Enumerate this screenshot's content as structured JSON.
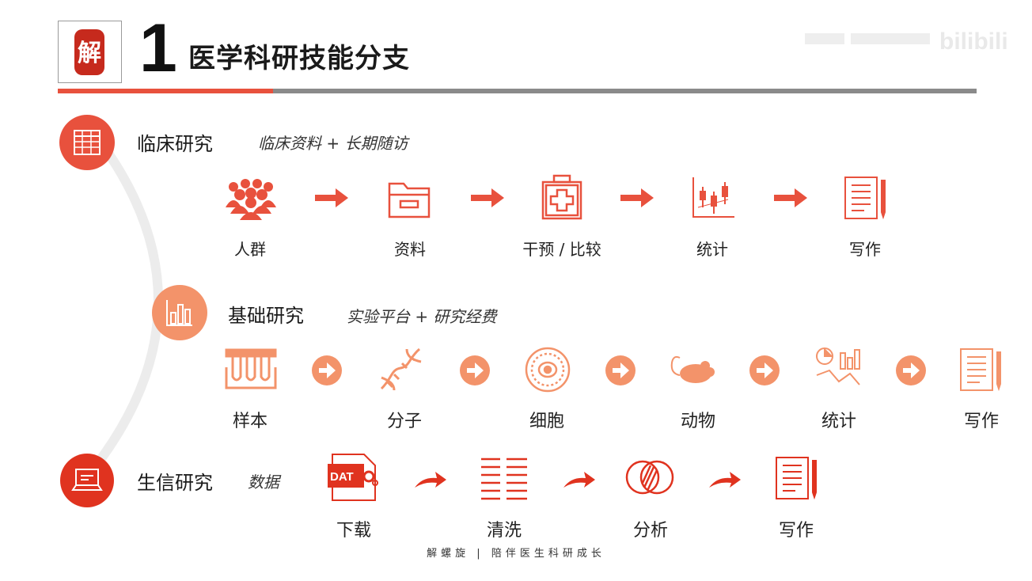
{
  "header": {
    "number": "1",
    "title": "医学科研技能分支",
    "logo_char": "解"
  },
  "sections": [
    {
      "title": "临床研究",
      "subtitle": "临床资料 + 长期随访",
      "steps": [
        "人群",
        "资料",
        "干预 / 比较",
        "统计",
        "写作"
      ]
    },
    {
      "title": "基础研究",
      "subtitle": "实验平台 + 研究经费",
      "steps": [
        "样本",
        "分子",
        "细胞",
        "动物",
        "统计",
        "写作"
      ]
    },
    {
      "title": "生信研究",
      "subtitle": "数据",
      "steps": [
        "下载",
        "清洗",
        "分析",
        "写作"
      ]
    }
  ],
  "icons": {
    "clinical": [
      "crowd-icon",
      "folder-icon",
      "medical-kit-icon",
      "candlestick-chart-icon",
      "document-icon"
    ],
    "basic": [
      "test-tubes-icon",
      "dna-icon",
      "cell-icon",
      "mouse-icon",
      "stats-icon",
      "document-icon"
    ],
    "bio": [
      "data-file-icon",
      "lines-icon",
      "venn-icon",
      "document-icon"
    ]
  },
  "data_icon_text": "DAT",
  "footer": "解螺旋 | 陪伴医生科研成长",
  "colors": {
    "accent": "#e8513d",
    "orange": "#f3936a",
    "gray_bar": "#8a8a8a"
  }
}
